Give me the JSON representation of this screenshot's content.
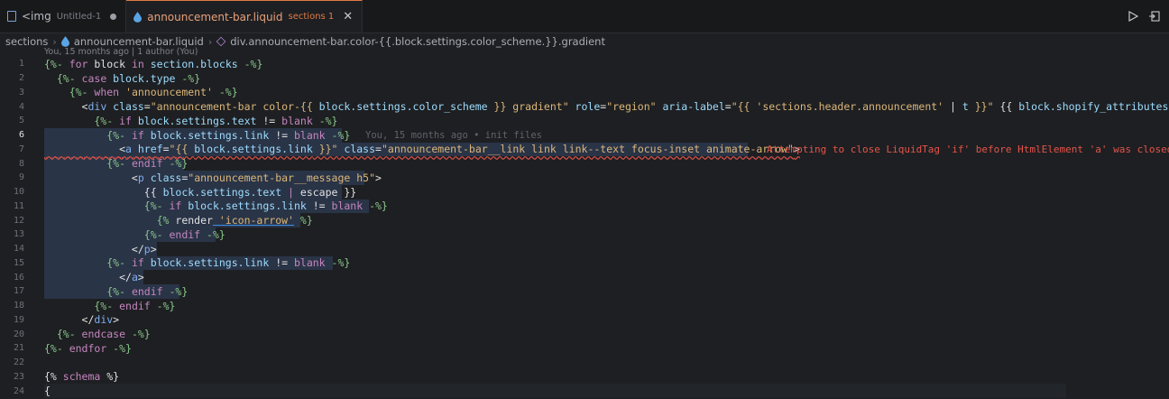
{
  "tabs": [
    {
      "label": "<img",
      "sub": "Untitled-1",
      "dirty": true,
      "active": false
    },
    {
      "label": "announcement-bar.liquid",
      "sub": "sections 1",
      "active": true,
      "close": "✕"
    }
  ],
  "actions": {
    "run_icon": "play-icon",
    "split_icon": "split-editor-icon"
  },
  "breadcrumb": {
    "folder": "sections",
    "file": "announcement-bar.liquid",
    "symbol": "div.announcement-bar.color-{{.block.settings.color_scheme.}}.gradient"
  },
  "blame": {
    "header": "You, 15 months ago | 1 author (You)",
    "inline": "You, 15 months ago • init files"
  },
  "error_message": "Attempting to close LiquidTag 'if' before HtmlElement 'a' was closed",
  "current_line": 6,
  "lines": [
    {
      "n": "1"
    },
    {
      "n": "2"
    },
    {
      "n": "3"
    },
    {
      "n": "4"
    },
    {
      "n": "5"
    },
    {
      "n": "6"
    },
    {
      "n": "7"
    },
    {
      "n": "8"
    },
    {
      "n": "9"
    },
    {
      "n": "10"
    },
    {
      "n": "11"
    },
    {
      "n": "12"
    },
    {
      "n": "13"
    },
    {
      "n": "14"
    },
    {
      "n": "15"
    },
    {
      "n": "16"
    },
    {
      "n": "17"
    },
    {
      "n": "18"
    },
    {
      "n": "19"
    },
    {
      "n": "20"
    },
    {
      "n": "21"
    },
    {
      "n": "22"
    },
    {
      "n": "23"
    },
    {
      "n": "24"
    }
  ],
  "code": {
    "l1": [
      "{%- ",
      "for",
      " block ",
      "in",
      " section",
      ".blocks",
      " -%}"
    ],
    "l2": [
      "  {%- ",
      "case",
      " block",
      ".type",
      " -%}"
    ],
    "l3": [
      "    {%- ",
      "when",
      " 'announcement'",
      " -%}"
    ],
    "l4": [
      "      <",
      "div",
      " class",
      "=",
      "\"announcement-bar color-{{ ",
      "block.settings.color_scheme",
      " }} gradient\"",
      " role",
      "=",
      "\"region\"",
      " aria-label",
      "=",
      "\"{{ ",
      "'sections.header.announcement'",
      " | ",
      "t",
      " }}\"",
      " {{ ",
      "block.shopify_attributes",
      " }}>"
    ],
    "l5": [
      "        {%- ",
      "if",
      " block",
      ".settings.text",
      " != ",
      "blank",
      " -%}"
    ],
    "l6": [
      "          {%- ",
      "if",
      " block",
      ".settings.link",
      " != ",
      "blank",
      " -%}"
    ],
    "l7": [
      "            <",
      "a",
      " href",
      "=",
      "\"{{ ",
      "block.settings.link",
      " }}\"",
      " class",
      "=",
      "\"announcement-bar__link link link--text focus-inset animate-arrow\"",
      ">"
    ],
    "l8": [
      "          {%- ",
      "endif",
      " -%}"
    ],
    "l9": [
      "              <",
      "p",
      " class",
      "=",
      "\"announcement-bar__message h5\"",
      ">"
    ],
    "l10": [
      "                {{ ",
      "block",
      ".settings.text",
      " | ",
      "escape",
      " }}"
    ],
    "l11": [
      "                {%- ",
      "if",
      " block",
      ".settings.link",
      " != ",
      "blank",
      " -%}"
    ],
    "l12": [
      "                  {% ",
      "render",
      " 'icon-arrow'",
      " %}"
    ],
    "l13": [
      "                {%- ",
      "endif",
      " -%}"
    ],
    "l14": [
      "              </",
      "p",
      ">"
    ],
    "l15": [
      "          {%- ",
      "if",
      " block",
      ".settings.link",
      " != ",
      "blank",
      " -%}"
    ],
    "l16": [
      "            </",
      "a",
      ">"
    ],
    "l17": [
      "          {%- ",
      "endif",
      " -%}"
    ],
    "l18": [
      "        {%- ",
      "endif",
      " -%}"
    ],
    "l19": [
      "      </",
      "div",
      ">"
    ],
    "l20": [
      "  {%- ",
      "endcase",
      " -%}"
    ],
    "l21": [
      "{%- ",
      "endfor",
      " -%}"
    ],
    "l22": [
      ""
    ],
    "l23": [
      "{% ",
      "schema",
      " %}"
    ],
    "l24": [
      "{"
    ]
  }
}
